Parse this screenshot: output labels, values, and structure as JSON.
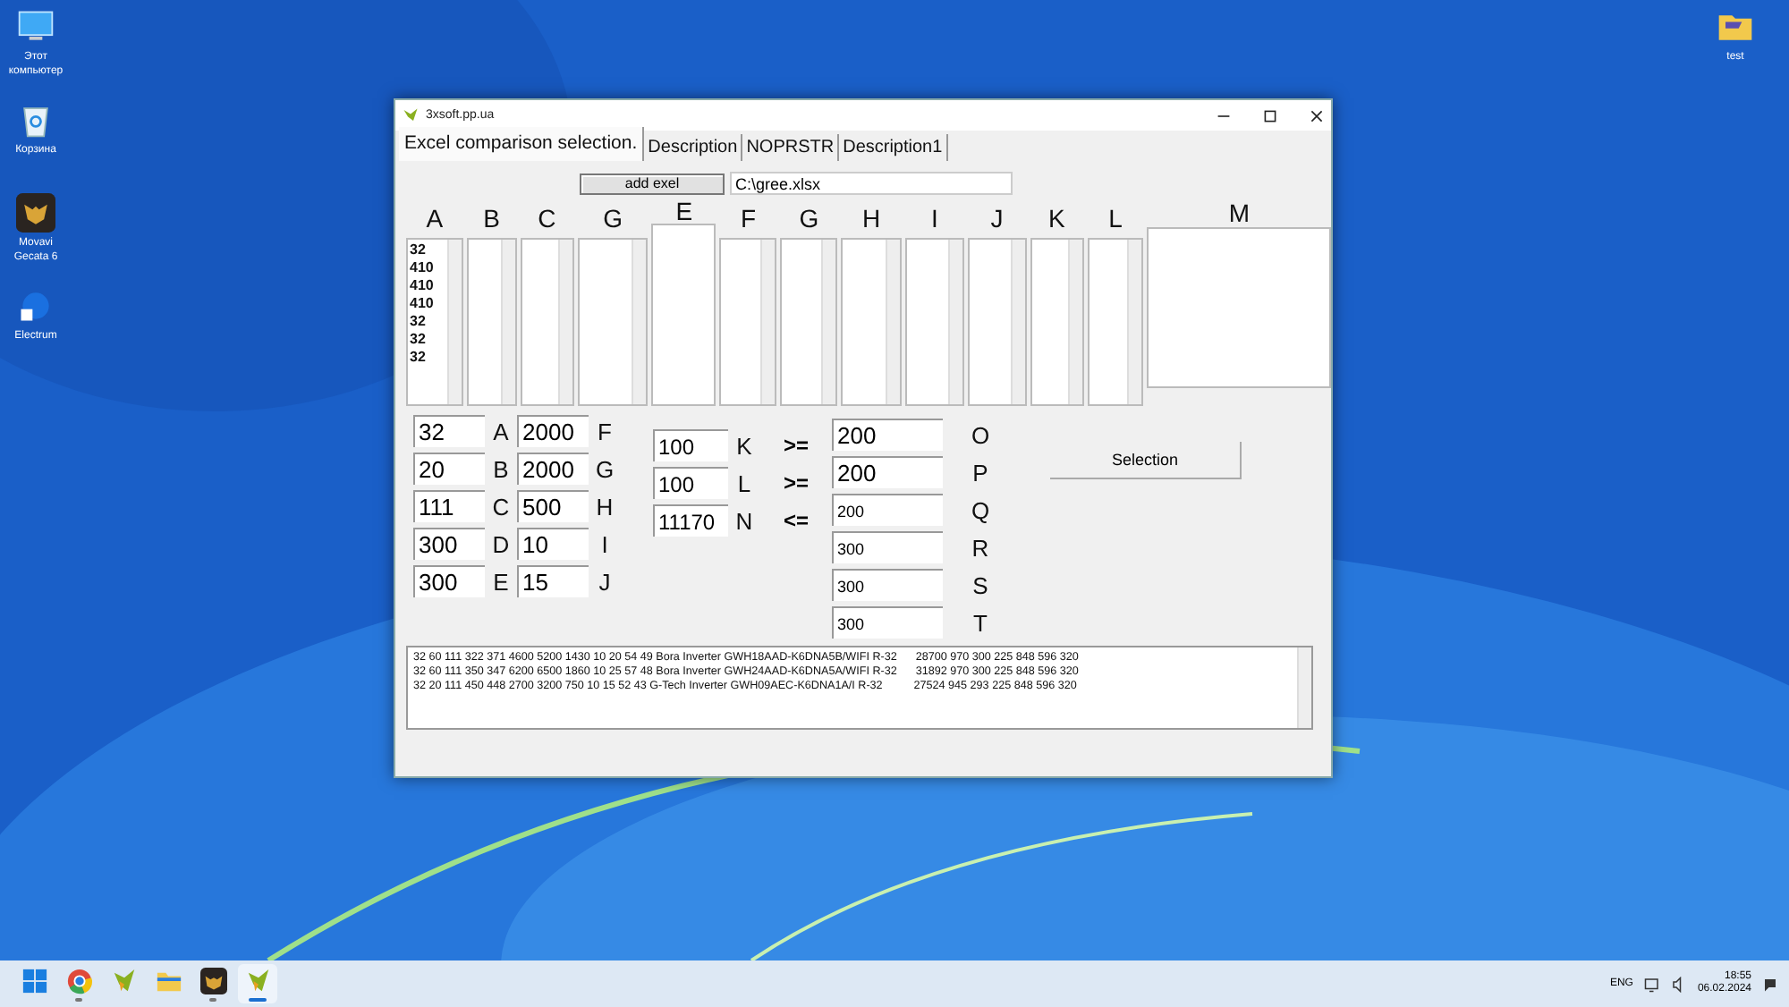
{
  "desktop_icons_left": [
    {
      "label": "Этот компьютер",
      "kind": "computer"
    },
    {
      "label": "Корзина",
      "kind": "recycle"
    },
    {
      "label": "Movavi Gecata 6",
      "kind": "gecata"
    },
    {
      "label": "Electrum",
      "kind": "electrum"
    }
  ],
  "desktop_icons_right": [
    {
      "label": "test",
      "kind": "folder"
    }
  ],
  "window": {
    "title": "3xsoft.pp.ua",
    "tabs": [
      {
        "label": "Excel comparison selection.",
        "selected": true
      },
      {
        "label": "Description",
        "selected": false
      },
      {
        "label": "NOPRSTR",
        "selected": false
      },
      {
        "label": "Description1",
        "selected": false
      }
    ],
    "add_button": "add exel",
    "file_path": "C:\\gree.xlsx",
    "columns": [
      {
        "letter": "A",
        "items": [
          "32",
          "410",
          "410",
          "410",
          "32",
          "32",
          "32"
        ]
      },
      {
        "letter": "B"
      },
      {
        "letter": "C"
      },
      {
        "letter": "G"
      },
      {
        "letter": "E"
      },
      {
        "letter": "F"
      },
      {
        "letter": "G"
      },
      {
        "letter": "H"
      },
      {
        "letter": "I"
      },
      {
        "letter": "J"
      },
      {
        "letter": "K"
      },
      {
        "letter": "L"
      },
      {
        "letter": "M"
      }
    ],
    "params_1": [
      {
        "value": "32",
        "letter": "A"
      },
      {
        "value": "20",
        "letter": "B"
      },
      {
        "value": "111",
        "letter": "C"
      },
      {
        "value": "300",
        "letter": "D"
      },
      {
        "value": "300",
        "letter": "E"
      }
    ],
    "params_2": [
      {
        "value": "2000",
        "letter": "F"
      },
      {
        "value": "2000",
        "letter": "G"
      },
      {
        "value": "500",
        "letter": "H"
      },
      {
        "value": "10",
        "letter": "I"
      },
      {
        "value": "15",
        "letter": "J"
      }
    ],
    "limits": [
      {
        "value": "100",
        "letter": "K",
        "op": ">="
      },
      {
        "value": "100",
        "letter": "L",
        "op": ">="
      },
      {
        "value": "11170",
        "letter": "N",
        "op": "<="
      }
    ],
    "outputs": [
      {
        "value": "200",
        "letter": "O"
      },
      {
        "value": "200",
        "letter": "P"
      },
      {
        "value": "200",
        "letter": "Q"
      },
      {
        "value": "300",
        "letter": "R"
      },
      {
        "value": "300",
        "letter": "S"
      },
      {
        "value": "300",
        "letter": "T"
      }
    ],
    "selection_button": "Selection",
    "results": [
      "32 60 111 322 371 4600 5200 1430 10 20 54 49 Bora Inverter GWH18AAD-K6DNA5B/WIFI R-32      28700 970 300 225 848 596 320",
      "32 60 111 350 347 6200 6500 1860 10 25 57 48 Bora Inverter GWH24AAD-K6DNA5A/WIFI R-32      31892 970 300 225 848 596 320",
      "32 20 111 450 448 2700 3200 750 10 15 52 43 G-Tech Inverter GWH09AEC-K6DNA1A/I R-32          27524 945 293 225 848 596 320"
    ]
  },
  "taskbar": {
    "apps": [
      {
        "kind": "start",
        "running": false,
        "selected": false
      },
      {
        "kind": "chrome",
        "running": true,
        "selected": false
      },
      {
        "kind": "app",
        "running": false,
        "selected": false
      },
      {
        "kind": "explorer",
        "running": false,
        "selected": false
      },
      {
        "kind": "gecata",
        "running": true,
        "selected": false
      },
      {
        "kind": "app",
        "running": true,
        "selected": true
      }
    ],
    "language": "ENG",
    "time": "18:55",
    "date": "06.02.2024"
  }
}
